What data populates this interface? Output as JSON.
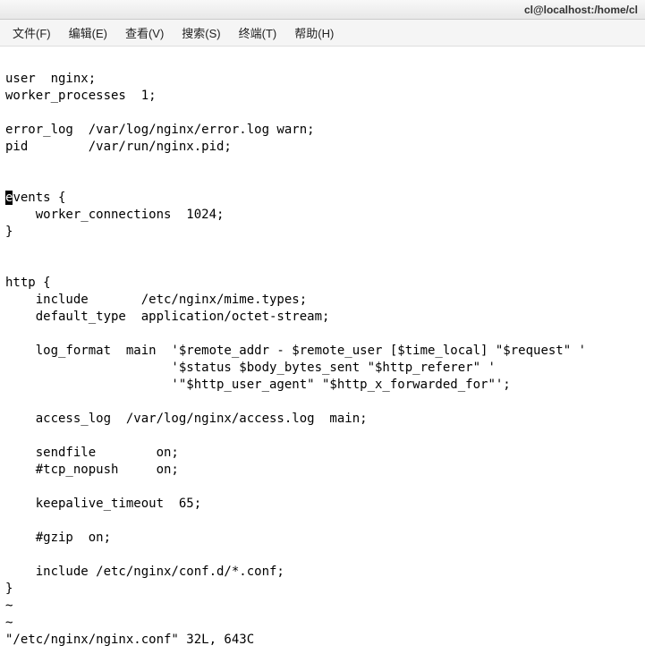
{
  "window": {
    "title": "cl@localhost:/home/cl"
  },
  "menu": {
    "file": "文件(F)",
    "edit": "编辑(E)",
    "view": "查看(V)",
    "search": "搜索(S)",
    "terminal": "终端(T)",
    "help": "帮助(H)"
  },
  "editor": {
    "lines": {
      "l0": "",
      "l1": "user  nginx;",
      "l2": "worker_processes  1;",
      "l3": "",
      "l4": "error_log  /var/log/nginx/error.log warn;",
      "l5": "pid        /var/run/nginx.pid;",
      "l6": "",
      "l7": "",
      "l8_cursor": "e",
      "l8_rest": "vents {",
      "l9": "    worker_connections  1024;",
      "l10": "}",
      "l11": "",
      "l12": "",
      "l13": "http {",
      "l14": "    include       /etc/nginx/mime.types;",
      "l15": "    default_type  application/octet-stream;",
      "l16": "",
      "l17": "    log_format  main  '$remote_addr - $remote_user [$time_local] \"$request\" '",
      "l18": "                      '$status $body_bytes_sent \"$http_referer\" '",
      "l19": "                      '\"$http_user_agent\" \"$http_x_forwarded_for\"';",
      "l20": "",
      "l21": "    access_log  /var/log/nginx/access.log  main;",
      "l22": "",
      "l23": "    sendfile        on;",
      "l24": "    #tcp_nopush     on;",
      "l25": "",
      "l26": "    keepalive_timeout  65;",
      "l27": "",
      "l28": "    #gzip  on;",
      "l29": "",
      "l30": "    include /etc/nginx/conf.d/*.conf;",
      "l31": "}"
    },
    "tilde": "~",
    "status": "\"/etc/nginx/nginx.conf\" 32L, 643C"
  }
}
